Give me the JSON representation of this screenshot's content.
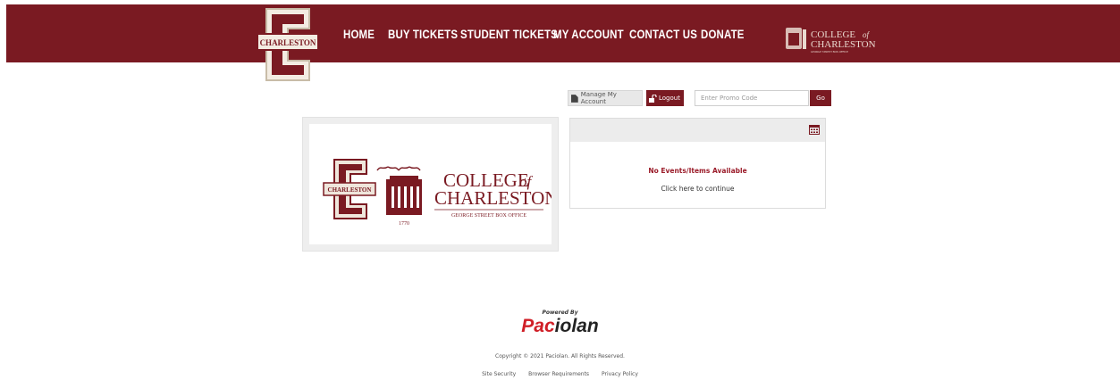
{
  "header": {
    "nav": [
      "HOME",
      "BUY TICKETS",
      "STUDENT TICKETS",
      "MY ACCOUNT",
      "CONTACT US",
      "DONATE"
    ],
    "logo_text": "CHARLESTON",
    "cofc": {
      "line1": "COLLEGE",
      "of": "of",
      "line2": "CHARLESTON",
      "sub": "GEORGE STREET BOX OFFICE"
    }
  },
  "account": {
    "manage_label": "Manage My Account",
    "logout_label": "Logout",
    "promo_placeholder": "Enter Promo Code",
    "go_label": "Go"
  },
  "logo_panel": {
    "badge": "CHARLESTON",
    "college": "COLLEGE",
    "of": "of",
    "charleston": "CHARLESTON",
    "box_office": "GEORGE STREET BOX OFFICE",
    "year": "1770"
  },
  "events": {
    "no_events": "No Events/Items Available",
    "continue": "Click here to continue"
  },
  "footer": {
    "powered_by": "Powered By",
    "brand_a": "Pac",
    "brand_b": "iolan",
    "copyright": "Copyright © 2021 Paciolan. All Rights Reserved.",
    "links": [
      "Site Security",
      "Browser Requirements",
      "Privacy Policy"
    ]
  },
  "colors": {
    "brand": "#7a1a22",
    "header_bg": "#7a1a22",
    "alert": "#9b1c2a",
    "paciolan_red": "#d01f27"
  }
}
